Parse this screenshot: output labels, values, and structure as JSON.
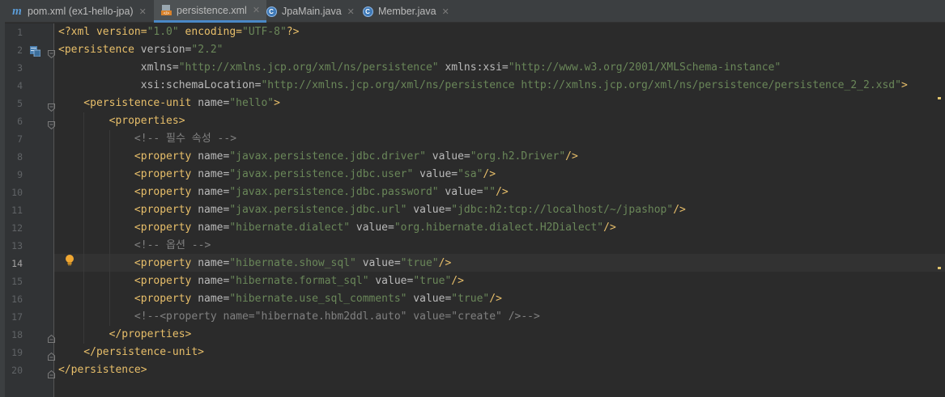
{
  "tabs": [
    {
      "label": "pom.xml (ex1-hello-jpa)",
      "icon": "maven-m-icon",
      "active": false
    },
    {
      "label": "persistence.xml",
      "icon": "xml-file-icon",
      "active": true
    },
    {
      "label": "JpaMain.java",
      "icon": "java-class-icon",
      "active": false
    },
    {
      "label": "Member.java",
      "icon": "java-class-icon",
      "active": false
    }
  ],
  "editor": {
    "current_line": 14,
    "lines": [
      {
        "n": "1",
        "segs": [
          [
            "p",
            "<?xml version="
          ],
          [
            "v",
            "\"1.0\""
          ],
          [
            "p",
            " encoding="
          ],
          [
            "v",
            "\"UTF-8\""
          ],
          [
            "p",
            "?>"
          ]
        ]
      },
      {
        "n": "2",
        "segs": [
          [
            "t",
            "<persistence "
          ],
          [
            "a",
            "version="
          ],
          [
            "v",
            "\"2.2\""
          ]
        ]
      },
      {
        "n": "3",
        "segs": [
          [
            "a",
            "             xmlns="
          ],
          [
            "v",
            "\"http://xmlns.jcp.org/xml/ns/persistence\""
          ],
          [
            "a",
            " xmlns:xsi="
          ],
          [
            "v",
            "\"http://www.w3.org/2001/XMLSchema-instance\""
          ]
        ]
      },
      {
        "n": "4",
        "segs": [
          [
            "a",
            "             xsi:schemaLocation="
          ],
          [
            "v",
            "\"http://xmlns.jcp.org/xml/ns/persistence http://xmlns.jcp.org/xml/ns/persistence/persistence_2_2.xsd\""
          ],
          [
            "t",
            ">"
          ]
        ]
      },
      {
        "n": "5",
        "segs": [
          [
            "t",
            "    <persistence-unit "
          ],
          [
            "a",
            "name="
          ],
          [
            "v",
            "\"hello\""
          ],
          [
            "t",
            ">"
          ]
        ]
      },
      {
        "n": "6",
        "segs": [
          [
            "t",
            "        <properties>"
          ]
        ]
      },
      {
        "n": "7",
        "segs": [
          [
            "c",
            "            <!-- 필수 속성 -->"
          ]
        ]
      },
      {
        "n": "8",
        "segs": [
          [
            "t",
            "            <property "
          ],
          [
            "a",
            "name="
          ],
          [
            "v",
            "\"javax.persistence.jdbc.driver\""
          ],
          [
            "a",
            " value="
          ],
          [
            "v",
            "\"org.h2.Driver\""
          ],
          [
            "t",
            "/>"
          ]
        ]
      },
      {
        "n": "9",
        "segs": [
          [
            "t",
            "            <property "
          ],
          [
            "a",
            "name="
          ],
          [
            "v",
            "\"javax.persistence.jdbc.user\""
          ],
          [
            "a",
            " value="
          ],
          [
            "v",
            "\"sa\""
          ],
          [
            "t",
            "/>"
          ]
        ]
      },
      {
        "n": "10",
        "segs": [
          [
            "t",
            "            <property "
          ],
          [
            "a",
            "name="
          ],
          [
            "v",
            "\"javax.persistence.jdbc.password\""
          ],
          [
            "a",
            " value="
          ],
          [
            "v",
            "\"\""
          ],
          [
            "t",
            "/>"
          ]
        ]
      },
      {
        "n": "11",
        "segs": [
          [
            "t",
            "            <property "
          ],
          [
            "a",
            "name="
          ],
          [
            "v",
            "\"javax.persistence.jdbc.url\""
          ],
          [
            "a",
            " value="
          ],
          [
            "v",
            "\"jdbc:h2:tcp://localhost/~/jpashop\""
          ],
          [
            "t",
            "/>"
          ]
        ]
      },
      {
        "n": "12",
        "segs": [
          [
            "t",
            "            <property "
          ],
          [
            "a",
            "name="
          ],
          [
            "v",
            "\"hibernate.dialect\""
          ],
          [
            "a",
            " value="
          ],
          [
            "v",
            "\"org.hibernate.dialect.H2Dialect\""
          ],
          [
            "t",
            "/>"
          ]
        ]
      },
      {
        "n": "13",
        "segs": [
          [
            "c",
            "            <!-- 옵션 -->"
          ]
        ]
      },
      {
        "n": "14",
        "segs": [
          [
            "t",
            "            <property "
          ],
          [
            "a",
            "name="
          ],
          [
            "v",
            "\"hibernate.show_sql\""
          ],
          [
            "a",
            " value="
          ],
          [
            "v",
            "\"true\""
          ],
          [
            "t",
            "/>"
          ]
        ]
      },
      {
        "n": "15",
        "segs": [
          [
            "t",
            "            <property "
          ],
          [
            "a",
            "name="
          ],
          [
            "v",
            "\"hibernate.format_sql\""
          ],
          [
            "a",
            " value="
          ],
          [
            "v",
            "\"true\""
          ],
          [
            "t",
            "/>"
          ]
        ]
      },
      {
        "n": "16",
        "segs": [
          [
            "t",
            "            <property "
          ],
          [
            "a",
            "name="
          ],
          [
            "v",
            "\"hibernate.use_sql_comments\""
          ],
          [
            "a",
            " value="
          ],
          [
            "v",
            "\"true\""
          ],
          [
            "t",
            "/>"
          ]
        ]
      },
      {
        "n": "17",
        "segs": [
          [
            "c",
            "            <!--<property name=\"hibernate.hbm2ddl.auto\" value=\"create\" />-->"
          ]
        ]
      },
      {
        "n": "18",
        "segs": [
          [
            "t",
            "        </properties>"
          ]
        ]
      },
      {
        "n": "19",
        "segs": [
          [
            "t",
            "    </persistence-unit>"
          ]
        ]
      },
      {
        "n": "20",
        "segs": [
          [
            "t",
            "</persistence>"
          ]
        ]
      }
    ]
  },
  "colors": {
    "background": "#2b2b2b",
    "tag": "#e8bf6a",
    "attribute": "#bababa",
    "string": "#6a8759",
    "comment": "#808080",
    "accent": "#4a88c7"
  }
}
